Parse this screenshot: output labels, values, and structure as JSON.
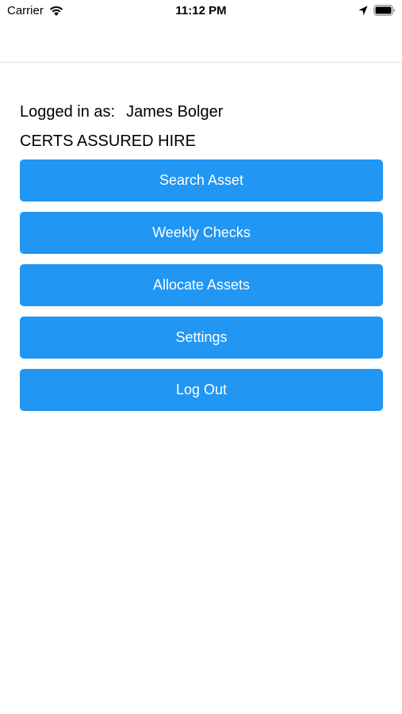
{
  "status_bar": {
    "carrier": "Carrier",
    "time": "11:12 PM",
    "icons": [
      "wifi-icon",
      "location-arrow-icon",
      "battery-icon"
    ]
  },
  "user": {
    "logged_in_label": "Logged in as:",
    "name": "James Bolger",
    "company": "CERTS ASSURED HIRE"
  },
  "menu": {
    "search_asset": "Search Asset",
    "weekly_checks": "Weekly Checks",
    "allocate_assets": "Allocate Assets",
    "settings": "Settings",
    "log_out": "Log Out"
  },
  "colors": {
    "button_background": "#2196F3",
    "button_text": "#FFFFFF",
    "text": "#000000",
    "nav_divider": "#DCDCDC"
  }
}
